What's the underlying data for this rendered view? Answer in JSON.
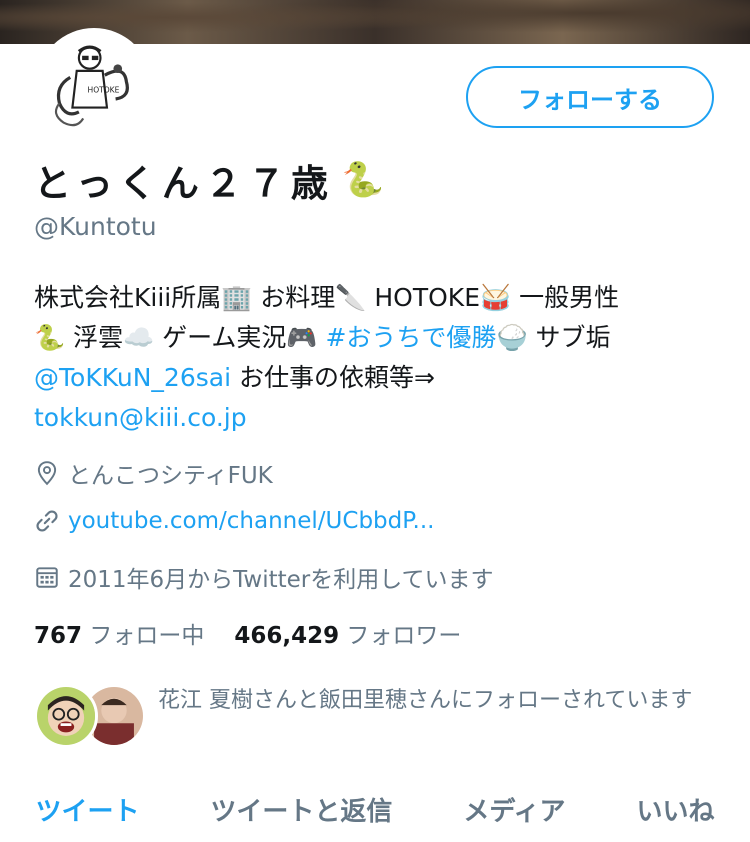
{
  "profile": {
    "display_name": "とっくん２７歳",
    "name_emoji": "🐍",
    "handle": "@Kuntotu",
    "follow_label": "フォローする"
  },
  "bio": {
    "line1_text": "株式会社Kiii所属🏢 お料理🔪 HOTOKE🥁 一般男性",
    "line2_text": "🐍 浮雲☁️ ゲーム実況🎮 ",
    "line2_hashtag": "#おうちで優勝",
    "line2_tail": "🍚 サブ垢",
    "line3_mention": "@ToKKuN_26sai",
    "line3_text": " お仕事の依頼等⇒",
    "line4_email": "tokkun@kiii.co.jp"
  },
  "meta": {
    "location": "とんこつシティFUK",
    "website": "youtube.com/channel/UCbbdP...",
    "joined": "2011年6月からTwitterを利用しています"
  },
  "stats": {
    "following_count": "767",
    "following_label": "フォロー中",
    "followers_count": "466,429",
    "followers_label": "フォロワー"
  },
  "followed_by": {
    "text": "花江 夏樹さんと飯田里穂さんにフォローされています"
  },
  "tabs": [
    {
      "label": "ツイート",
      "active": true
    },
    {
      "label": "ツイートと返信",
      "active": false
    },
    {
      "label": "メディア",
      "active": false
    },
    {
      "label": "いいね",
      "active": false
    }
  ],
  "colors": {
    "accent": "#1da1f2",
    "secondary_text": "#657786",
    "primary_text": "#14171a"
  },
  "icons": [
    "location-pin-icon",
    "link-icon",
    "calendar-icon"
  ]
}
